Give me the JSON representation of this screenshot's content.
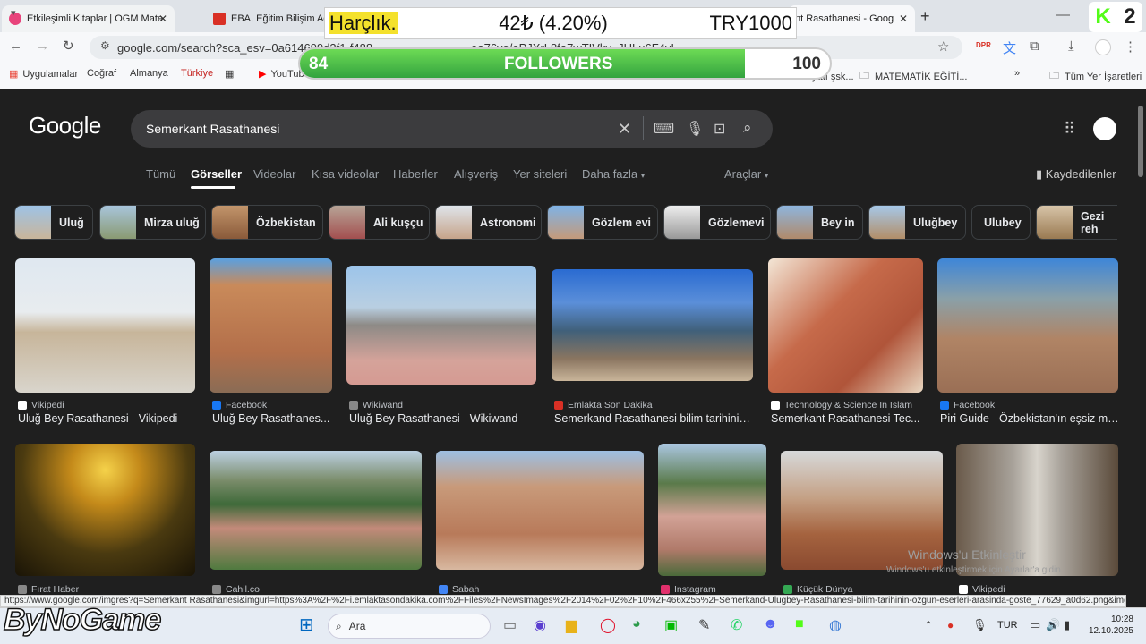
{
  "browser": {
    "tabs": [
      {
        "label": "Etkileşimli Kitaplar | OGM Mate",
        "color": "#e8437b"
      },
      {
        "label": "EBA, Eğitim Bilişim Ağı",
        "color": "#d93025"
      },
      {
        "label": "nt Rasathanesi - Goog",
        "color": "#4285f4"
      }
    ],
    "new_tab": "+",
    "url": "google.com/search?sca_esv=0a614699d3f1-f488",
    "url_tail": "aa76ve/ePJXrL8fa7wTIVky_JULu6F4yI...",
    "bookmarks": [
      "Uygulamalar",
      "Coğraf",
      "Almanya",
      "Türkiye",
      "YouTube",
      "Divan edebiyatı şsk...",
      "MATEMATİK EĞİTİ...",
      "Tüm Yer İşaretleri"
    ]
  },
  "overlay": {
    "harclik_label": "Harçlık.",
    "harclik_amount": "42₺ (4.20%)",
    "harclik_goal": "TRY1000",
    "followers_current": "84",
    "followers_label": "FOLLOWERS",
    "followers_goal": "100",
    "followers_progress": 0.84,
    "k_badge": "K",
    "k_count": "2",
    "brand": "ByNoGame"
  },
  "google": {
    "logo": "Google",
    "query": "Semerkant Rasathanesi",
    "tabs": [
      "Tümü",
      "Görseller",
      "Videolar",
      "Kısa videolar",
      "Haberler",
      "Alışveriş",
      "Yer siteleri",
      "Daha fazla"
    ],
    "tools": "Araçlar",
    "saved": "Kaydedilenler",
    "chips": [
      "Uluğ",
      "Mirza uluğ",
      "Özbekistan",
      "Ali kuşçu",
      "Astronomi",
      "Gözlem evi",
      "Gözlemevi",
      "Bey in",
      "Uluğbey",
      "Ulubey",
      "Gezi reh"
    ],
    "results_row1": [
      {
        "source": "Vikipedi",
        "title": "Uluğ Bey Rasathanesi - Vikipedi"
      },
      {
        "source": "Facebook",
        "title": "Uluğ Bey Rasathanes..."
      },
      {
        "source": "Wikiwand",
        "title": "Uluğ Bey Rasathanesi - Wikiwand"
      },
      {
        "source": "Emlakta Son Dakika",
        "title": "Semerkand Rasathanesi bilim tarihinin..."
      },
      {
        "source": "Technology & Science In Islam",
        "title": "Semerkant Rasathanesi Tec..."
      },
      {
        "source": "Facebook",
        "title": "Piri Guide - Özbekistan'ın eşsiz mi..."
      }
    ],
    "results_row2": [
      {
        "source": "Fırat Haber"
      },
      {
        "source": "Cahil.co"
      },
      {
        "source": "Sabah"
      },
      {
        "source": "Instagram"
      },
      {
        "source": "Küçük Dünya"
      },
      {
        "source": "Vikipedi"
      }
    ],
    "status_url": "https://www.google.com/imgres?q=Semerkant Rasathanesi&imgurl=https%3A%2F%2Fi.emlaktasondakika.com%2FFiles%2FNewsImages%2F2014%2F02%2F10%2F466x255%2FSemerkand-Ulugbey-Rasathanesi-bilim-tarihinin-ozgun-eserleri-arasinda-goste_77629_a0d62.png&imgr...",
    "watermark_line1": "Windows'u Etkinleştir",
    "watermark_line2": "Windows'u etkinleştirmek için Ayarlar'a gidin."
  },
  "taskbar": {
    "search": "Ara",
    "lang": "TUR",
    "time": "10:28",
    "date": "12.10.2025"
  }
}
